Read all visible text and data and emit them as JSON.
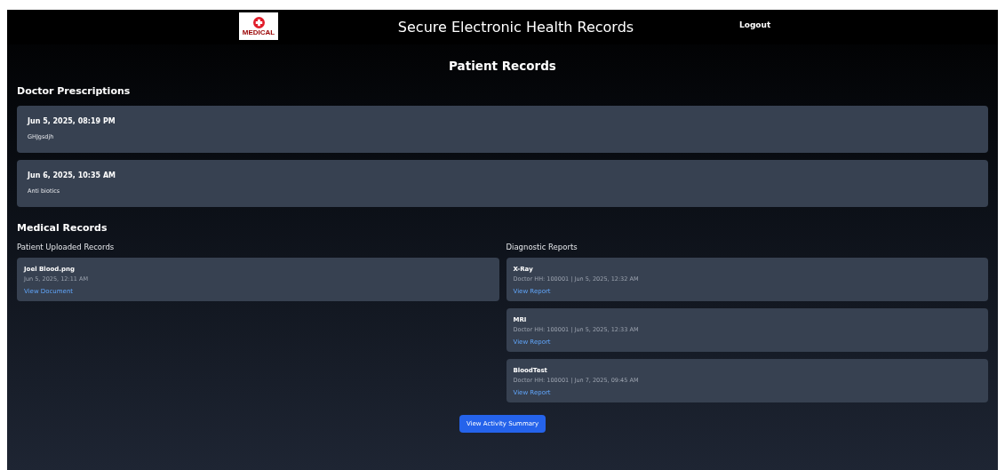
{
  "header": {
    "logo_text": "MEDICAL",
    "title": "Secure Electronic Health Records",
    "logout": "Logout"
  },
  "page_title": "Patient Records",
  "prescriptions": {
    "heading": "Doctor Prescriptions",
    "items": [
      {
        "date": "Jun 5, 2025, 08:19 PM",
        "text": "GHJgsdjh"
      },
      {
        "date": "Jun 6, 2025, 10:35 AM",
        "text": "Anti biotics"
      }
    ]
  },
  "medical_records": {
    "heading": "Medical Records",
    "uploaded": {
      "heading": "Patient Uploaded Records",
      "items": [
        {
          "name": "Joel Blood.png",
          "meta": "Jun 5, 2025, 12:11 AM",
          "link": "View Document"
        }
      ]
    },
    "diagnostic": {
      "heading": "Diagnostic Reports",
      "items": [
        {
          "name": "X-Ray",
          "meta": "Doctor HH: 100001 | Jun 5, 2025, 12:32 AM",
          "link": "View Report"
        },
        {
          "name": "MRI",
          "meta": "Doctor HH: 100001 | Jun 5, 2025, 12:33 AM",
          "link": "View Report"
        },
        {
          "name": "BloodTest",
          "meta": "Doctor HH: 100001 | Jun 7, 2025, 09:45 AM",
          "link": "View Report"
        }
      ]
    }
  },
  "summary_button": "View Activity Summary"
}
